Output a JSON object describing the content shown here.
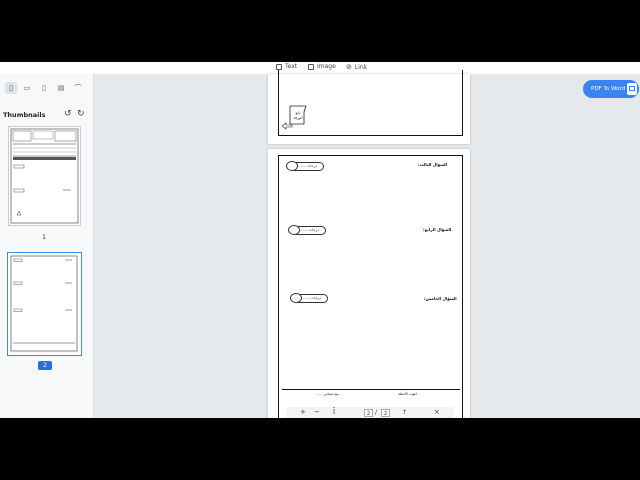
{
  "toolbar": {
    "text_label": "Text",
    "image_label": "Image",
    "link_label": "Link"
  },
  "sidebar": {
    "title": "Thumbnails",
    "tabs": [
      "thumbnails-icon",
      "comment-icon",
      "bookmark-icon",
      "layers-icon",
      "attachment-icon"
    ],
    "thumbnails": [
      {
        "page": "1",
        "selected": false
      },
      {
        "page": "2",
        "selected": true
      }
    ]
  },
  "document": {
    "page1_stamp": "ص\nالورقة",
    "questions": [
      {
        "label": "السؤال الثالث:",
        "grade": "........ درجات"
      },
      {
        "label": "السؤال الرابع:",
        "grade": "........ درجات"
      },
      {
        "label": "السؤال الخامس:",
        "grade": "........ درجات"
      }
    ],
    "footer_right": "انتهت الأسئلة",
    "footer_left": "مع تمنياتي ......"
  },
  "pdf_to_word_label": "PDF To Word",
  "pager": {
    "zoom_in": "+",
    "zoom_out": "−",
    "fit": "Ī",
    "current": "2",
    "separator": "/",
    "total": "2",
    "up": "↑",
    "close": "×"
  },
  "colors": {
    "accent": "#3b82f6",
    "selected_border": "#3d8bf0",
    "background": "#e6e9ec"
  }
}
